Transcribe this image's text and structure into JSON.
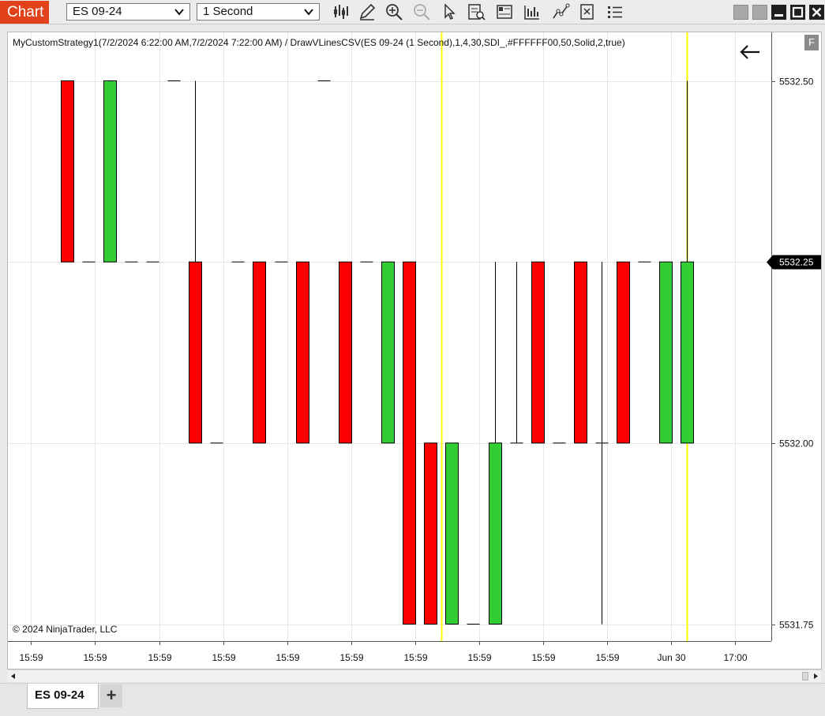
{
  "toolbar": {
    "chart_label": "Chart",
    "instrument": "ES 09-24",
    "interval": "1 Second",
    "tools": [
      "bar-style-icon",
      "drawing-tools-icon",
      "zoom-in-icon",
      "zoom-out-icon",
      "pointer-icon",
      "data-box-icon",
      "chart-properties-icon",
      "indicators-icon",
      "strategies-icon",
      "templates-icon",
      "properties-icon"
    ]
  },
  "chart": {
    "legend": "MyCustomStrategy1(7/2/2024 6:22:00 AM,7/2/2024 7:22:00 AM) / DrawVLinesCSV(ES 09-24 (1 Second),1,4,30,SDI_,#FFFFFF00,50,Solid,2,true)",
    "copyright": "© 2024 NinjaTrader, LLC",
    "f_badge": "F",
    "price_marker": "5532.25"
  },
  "chart_data": {
    "type": "candlestick",
    "y_ticks": [
      "5532.50",
      "5532.25",
      "5532.00",
      "5531.75"
    ],
    "ylim": [
      5531.75,
      5532.5
    ],
    "x_ticks": [
      "15:59",
      "15:59",
      "15:59",
      "15:59",
      "15:59",
      "15:59",
      "15:59",
      "15:59",
      "15:59",
      "15:59",
      "Jun 30",
      "17:00"
    ],
    "colors": {
      "up": "#32cd32",
      "down": "#ff0000",
      "vline": "#ffff00"
    },
    "bars": [
      {
        "o": 5532.5,
        "h": 5532.5,
        "l": 5532.25,
        "c": 5532.25
      },
      {
        "o": 5532.25,
        "h": 5532.25,
        "l": 5532.25,
        "c": 5532.25
      },
      {
        "o": 5532.25,
        "h": 5532.5,
        "l": 5532.25,
        "c": 5532.5
      },
      {
        "o": 5532.25,
        "h": 5532.25,
        "l": 5532.25,
        "c": 5532.25
      },
      {
        "o": 5532.25,
        "h": 5532.25,
        "l": 5532.25,
        "c": 5532.25
      },
      {
        "o": 5532.5,
        "h": 5532.5,
        "l": 5532.5,
        "c": 5532.5
      },
      {
        "o": 5532.25,
        "h": 5532.5,
        "l": 5532.0,
        "c": 5532.0
      },
      {
        "o": 5532.0,
        "h": 5532.0,
        "l": 5532.0,
        "c": 5532.0
      },
      {
        "o": 5532.25,
        "h": 5532.25,
        "l": 5532.25,
        "c": 5532.25
      },
      {
        "o": 5532.25,
        "h": 5532.25,
        "l": 5532.0,
        "c": 5532.0
      },
      {
        "o": 5532.25,
        "h": 5532.25,
        "l": 5532.25,
        "c": 5532.25
      },
      {
        "o": 5532.25,
        "h": 5532.25,
        "l": 5532.0,
        "c": 5532.0
      },
      {
        "o": 5532.5,
        "h": 5532.5,
        "l": 5532.5,
        "c": 5532.5
      },
      {
        "o": 5532.25,
        "h": 5532.25,
        "l": 5532.0,
        "c": 5532.0
      },
      {
        "o": 5532.25,
        "h": 5532.25,
        "l": 5532.25,
        "c": 5532.25
      },
      {
        "o": 5532.0,
        "h": 5532.25,
        "l": 5532.0,
        "c": 5532.25
      },
      {
        "o": 5532.25,
        "h": 5532.25,
        "l": 5531.75,
        "c": 5531.75
      },
      {
        "o": 5532.0,
        "h": 5532.0,
        "l": 5531.75,
        "c": 5531.75
      },
      {
        "o": 5531.75,
        "h": 5532.0,
        "l": 5531.75,
        "c": 5532.0
      },
      {
        "o": 5531.75,
        "h": 5531.75,
        "l": 5531.75,
        "c": 5531.75
      },
      {
        "o": 5531.75,
        "h": 5532.25,
        "l": 5531.75,
        "c": 5532.0
      },
      {
        "o": 5532.0,
        "h": 5532.25,
        "l": 5532.0,
        "c": 5532.0
      },
      {
        "o": 5532.25,
        "h": 5532.25,
        "l": 5532.0,
        "c": 5532.0
      },
      {
        "o": 5532.0,
        "h": 5532.0,
        "l": 5532.0,
        "c": 5532.0
      },
      {
        "o": 5532.25,
        "h": 5532.25,
        "l": 5532.0,
        "c": 5532.0
      },
      {
        "o": 5532.0,
        "h": 5532.25,
        "l": 5531.75,
        "c": 5532.0
      },
      {
        "o": 5532.25,
        "h": 5532.25,
        "l": 5532.0,
        "c": 5532.0
      },
      {
        "o": 5532.25,
        "h": 5532.25,
        "l": 5532.25,
        "c": 5532.25
      },
      {
        "o": 5532.0,
        "h": 5532.25,
        "l": 5532.0,
        "c": 5532.25
      },
      {
        "o": 5532.0,
        "h": 5532.5,
        "l": 5532.0,
        "c": 5532.25
      }
    ],
    "vlines_bar_index": [
      17.5,
      29
    ]
  },
  "tabs": {
    "active": "ES 09-24",
    "add": "+"
  }
}
